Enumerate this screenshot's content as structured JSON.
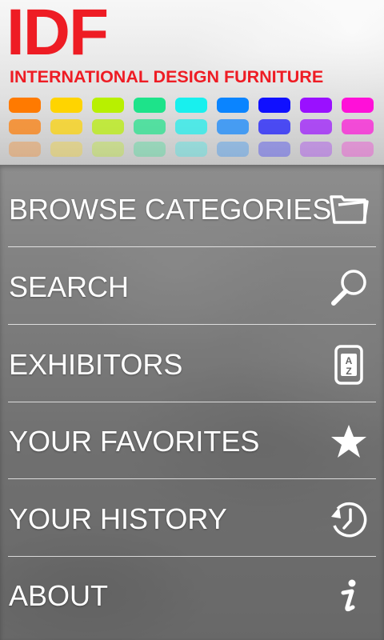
{
  "header": {
    "logo_text": "IDF",
    "tagline": "INTERNATIONAL DESIGN FURNITURE",
    "brand_color": "#ee1c24",
    "swatch_colors": [
      "#ff7a00",
      "#ffd400",
      "#b8f000",
      "#1de38a",
      "#18f0ee",
      "#0a84ff",
      "#1010ff",
      "#9a10ff",
      "#ff10d8"
    ]
  },
  "menu": {
    "items": [
      {
        "label": "BROWSE CATEGORIES",
        "icon": "folder-icon"
      },
      {
        "label": "SEARCH",
        "icon": "search-icon"
      },
      {
        "label": "EXHIBITORS",
        "icon": "az-list-icon"
      },
      {
        "label": "YOUR FAVORITES",
        "icon": "star-icon"
      },
      {
        "label": "YOUR HISTORY",
        "icon": "history-icon"
      },
      {
        "label": "ABOUT",
        "icon": "info-icon"
      }
    ]
  }
}
